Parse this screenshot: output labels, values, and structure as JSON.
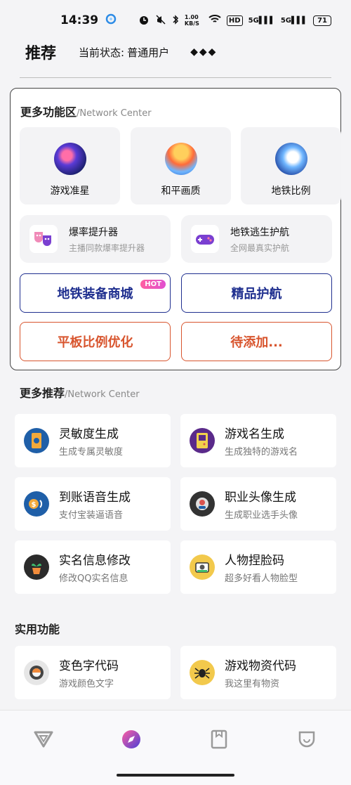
{
  "status_bar": {
    "time": "14:39",
    "speed": "1.00 KB/S",
    "hd": "HD",
    "signal1": "5G",
    "signal2": "5G",
    "battery": "71"
  },
  "header": {
    "title": "推荐",
    "status_label": "当前状态:",
    "status_value": "普通用户",
    "dots": "◆◆◆"
  },
  "feature_panel": {
    "title": "更多功能区",
    "subtitle": "/Network Center",
    "tiles": [
      {
        "label": "游戏准星",
        "icon": "rocket-planet-icon"
      },
      {
        "label": "和平画质",
        "icon": "planet-icon"
      },
      {
        "label": "地铁比例",
        "icon": "astronaut-icon"
      }
    ],
    "wide_cards": [
      {
        "title": "爆率提升器",
        "subtitle": "主播同款爆率提升器",
        "icon": "theater-masks-icon"
      },
      {
        "title": "地铁逃生护航",
        "subtitle": "全网最真实护航",
        "icon": "gamepad-icon"
      }
    ],
    "buttons": {
      "equipment_store": "地铁装备商城",
      "hot_badge": "HOT",
      "escort": "精品护航",
      "tablet_ratio": "平板比例优化",
      "pending": "待添加..."
    }
  },
  "more_recommended": {
    "title": "更多推荐",
    "subtitle": "/Network Center",
    "items": [
      {
        "title": "灵敏度生成",
        "subtitle": "生成专属灵敏度",
        "icon": "phone-settings-icon"
      },
      {
        "title": "游戏名生成",
        "subtitle": "生成独特的游戏名",
        "icon": "gameboy-icon"
      },
      {
        "title": "到账语音生成",
        "subtitle": "支付宝装逼语音",
        "icon": "money-sound-icon"
      },
      {
        "title": "职业头像生成",
        "subtitle": "生成职业选手头像",
        "icon": "avatar-badge-icon"
      },
      {
        "title": "实名信息修改",
        "subtitle": "修改QQ实名信息",
        "icon": "plant-pot-icon"
      },
      {
        "title": "人物捏脸码",
        "subtitle": "超多好看人物脸型",
        "icon": "camera-face-icon"
      }
    ]
  },
  "practical": {
    "title": "实用功能",
    "items": [
      {
        "title": "变色字代码",
        "subtitle": "游戏颜色文字",
        "icon": "color-roll-icon"
      },
      {
        "title": "游戏物资代码",
        "subtitle": "我这里有物资",
        "icon": "spider-icon"
      }
    ]
  },
  "colors": {
    "accent_blue": "#1f2f8f",
    "accent_red": "#d8552e",
    "hot_pink": "#ff5fa0"
  },
  "bottom_nav": [
    "v-logo-icon",
    "discover-icon",
    "bookmark-icon",
    "profile-icon"
  ]
}
